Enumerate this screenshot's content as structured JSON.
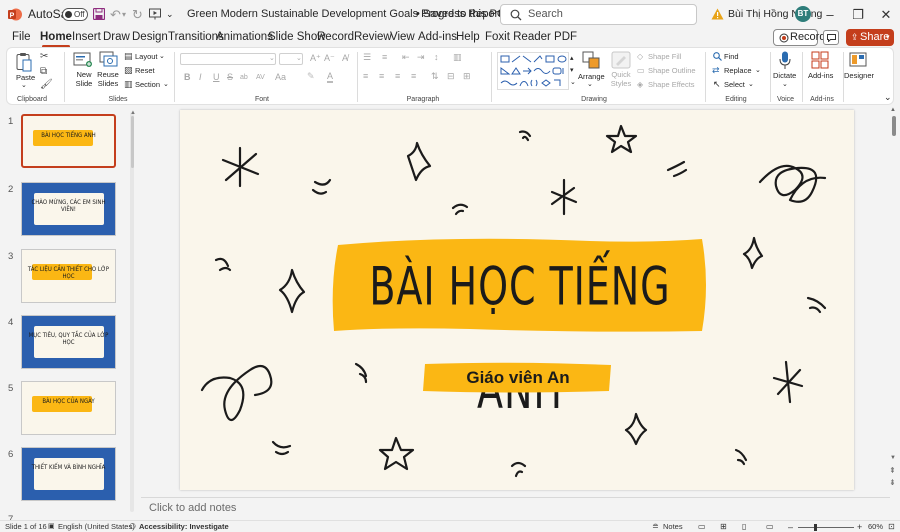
{
  "titlebar": {
    "autosave_label": "AutoSave",
    "autosave_state": "Off",
    "doc_title": "Green Modern Sustainable Development Goals Progress Report Present...",
    "save_status": "• Saved to this PC",
    "search_placeholder": "Search",
    "user_name": "Bùi Thị Hồng Nhung",
    "user_initials": "BT"
  },
  "menu": {
    "tabs": [
      "File",
      "Home",
      "Insert",
      "Draw",
      "Design",
      "Transitions",
      "Animations",
      "Slide Show",
      "Record",
      "Review",
      "View",
      "Add-ins",
      "Help",
      "Foxit Reader PDF"
    ],
    "active": "Home",
    "record_label": "Record",
    "share_label": "Share"
  },
  "ribbon": {
    "clipboard": {
      "paste_label": "Paste",
      "group_label": "Clipboard"
    },
    "slides": {
      "new_slide_label": "New Slide",
      "reuse_slides_label": "Reuse Slides",
      "layout_label": "Layout",
      "reset_label": "Reset",
      "section_label": "Section",
      "group_label": "Slides"
    },
    "font": {
      "group_label": "Font",
      "glyphs": [
        "B",
        "I",
        "U",
        "S",
        "ab",
        "AV",
        "Aa",
        "A"
      ]
    },
    "paragraph": {
      "group_label": "Paragraph"
    },
    "drawing": {
      "arrange_label": "Arrange",
      "quick_styles_label": "Quick Styles",
      "shape_fill_label": "Shape Fill",
      "shape_outline_label": "Shape Outline",
      "shape_effects_label": "Shape Effects",
      "group_label": "Drawing"
    },
    "editing": {
      "find_label": "Find",
      "replace_label": "Replace",
      "select_label": "Select",
      "group_label": "Editing"
    },
    "voice": {
      "dictate_label": "Dictate",
      "group_label": "Voice"
    },
    "addins": {
      "addins_label": "Add-ins",
      "group_label": "Add-ins"
    },
    "designer": {
      "designer_label": "Designer"
    }
  },
  "thumbnails": [
    {
      "num": "1",
      "label": "BÀI HỌC TIẾNG ANH",
      "bg": "#faf6eb",
      "selected": true
    },
    {
      "num": "2",
      "label": "CHÀO MỪNG, CÁC EM SINH VIÊN!",
      "bg": "#2b5fae"
    },
    {
      "num": "3",
      "label": "TÁC LIỆU CẦN THIẾT CHO LỚP HỌC",
      "bg": "#faf6eb"
    },
    {
      "num": "4",
      "label": "MỤC TIÊU, QUY TẮC CỦA LỚP HỌC",
      "bg": "#2b5fae"
    },
    {
      "num": "5",
      "label": "BÀI HỌC CỦA NGÀY",
      "bg": "#faf6eb"
    },
    {
      "num": "6",
      "label": "THIẾT KIẾM VÀ BÌNH NGHĨA",
      "bg": "#2b5fae"
    },
    {
      "num": "7",
      "label": "",
      "bg": "#faf6eb"
    }
  ],
  "slide": {
    "title": "BÀI HỌC TIẾNG ANH",
    "subtitle": "Giáo viên An",
    "colors": {
      "background": "#faf6eb",
      "highlight": "#fbb714",
      "ink": "#1b1b1b"
    }
  },
  "notes": {
    "placeholder": "Click to add notes"
  },
  "status": {
    "slide_info": "Slide 1 of 16",
    "language": "English (United States)",
    "accessibility": "Accessibility: Investigate",
    "notes_label": "Notes",
    "zoom": "60%"
  },
  "colors": {
    "accent": "#c43e1c",
    "chrome": "#f3f3f3",
    "ribbon": "#ffffff"
  }
}
